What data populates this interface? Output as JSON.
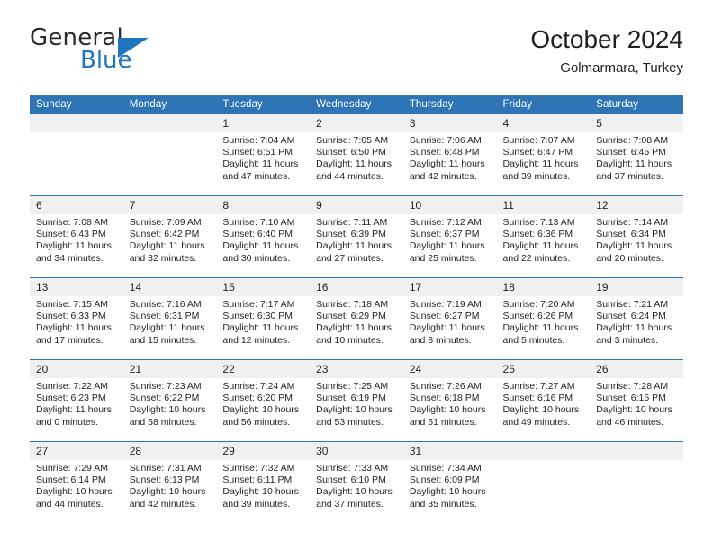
{
  "brand": {
    "name_part1": "General",
    "name_part2": "Blue",
    "flag_icon": "triangle-flag-icon"
  },
  "header": {
    "title": "October 2024",
    "subtitle": "Golmarmara, Turkey"
  },
  "colors": {
    "header_blue": "#2e75b6",
    "brand_blue": "#1f76bc",
    "daynum_band": "#f0f0f0",
    "text": "#231f20"
  },
  "calendar": {
    "weekday_headers": [
      "Sunday",
      "Monday",
      "Tuesday",
      "Wednesday",
      "Thursday",
      "Friday",
      "Saturday"
    ],
    "weeks": [
      [
        {
          "empty": true,
          "day": ""
        },
        {
          "empty": true,
          "day": ""
        },
        {
          "day": "1",
          "sunrise": "Sunrise: 7:04 AM",
          "sunset": "Sunset: 6:51 PM",
          "daylight_line1": "Daylight: 11 hours",
          "daylight_line2": "and 47 minutes."
        },
        {
          "day": "2",
          "sunrise": "Sunrise: 7:05 AM",
          "sunset": "Sunset: 6:50 PM",
          "daylight_line1": "Daylight: 11 hours",
          "daylight_line2": "and 44 minutes."
        },
        {
          "day": "3",
          "sunrise": "Sunrise: 7:06 AM",
          "sunset": "Sunset: 6:48 PM",
          "daylight_line1": "Daylight: 11 hours",
          "daylight_line2": "and 42 minutes."
        },
        {
          "day": "4",
          "sunrise": "Sunrise: 7:07 AM",
          "sunset": "Sunset: 6:47 PM",
          "daylight_line1": "Daylight: 11 hours",
          "daylight_line2": "and 39 minutes."
        },
        {
          "day": "5",
          "sunrise": "Sunrise: 7:08 AM",
          "sunset": "Sunset: 6:45 PM",
          "daylight_line1": "Daylight: 11 hours",
          "daylight_line2": "and 37 minutes."
        }
      ],
      [
        {
          "day": "6",
          "sunrise": "Sunrise: 7:08 AM",
          "sunset": "Sunset: 6:43 PM",
          "daylight_line1": "Daylight: 11 hours",
          "daylight_line2": "and 34 minutes."
        },
        {
          "day": "7",
          "sunrise": "Sunrise: 7:09 AM",
          "sunset": "Sunset: 6:42 PM",
          "daylight_line1": "Daylight: 11 hours",
          "daylight_line2": "and 32 minutes."
        },
        {
          "day": "8",
          "sunrise": "Sunrise: 7:10 AM",
          "sunset": "Sunset: 6:40 PM",
          "daylight_line1": "Daylight: 11 hours",
          "daylight_line2": "and 30 minutes."
        },
        {
          "day": "9",
          "sunrise": "Sunrise: 7:11 AM",
          "sunset": "Sunset: 6:39 PM",
          "daylight_line1": "Daylight: 11 hours",
          "daylight_line2": "and 27 minutes."
        },
        {
          "day": "10",
          "sunrise": "Sunrise: 7:12 AM",
          "sunset": "Sunset: 6:37 PM",
          "daylight_line1": "Daylight: 11 hours",
          "daylight_line2": "and 25 minutes."
        },
        {
          "day": "11",
          "sunrise": "Sunrise: 7:13 AM",
          "sunset": "Sunset: 6:36 PM",
          "daylight_line1": "Daylight: 11 hours",
          "daylight_line2": "and 22 minutes."
        },
        {
          "day": "12",
          "sunrise": "Sunrise: 7:14 AM",
          "sunset": "Sunset: 6:34 PM",
          "daylight_line1": "Daylight: 11 hours",
          "daylight_line2": "and 20 minutes."
        }
      ],
      [
        {
          "day": "13",
          "sunrise": "Sunrise: 7:15 AM",
          "sunset": "Sunset: 6:33 PM",
          "daylight_line1": "Daylight: 11 hours",
          "daylight_line2": "and 17 minutes."
        },
        {
          "day": "14",
          "sunrise": "Sunrise: 7:16 AM",
          "sunset": "Sunset: 6:31 PM",
          "daylight_line1": "Daylight: 11 hours",
          "daylight_line2": "and 15 minutes."
        },
        {
          "day": "15",
          "sunrise": "Sunrise: 7:17 AM",
          "sunset": "Sunset: 6:30 PM",
          "daylight_line1": "Daylight: 11 hours",
          "daylight_line2": "and 12 minutes."
        },
        {
          "day": "16",
          "sunrise": "Sunrise: 7:18 AM",
          "sunset": "Sunset: 6:29 PM",
          "daylight_line1": "Daylight: 11 hours",
          "daylight_line2": "and 10 minutes."
        },
        {
          "day": "17",
          "sunrise": "Sunrise: 7:19 AM",
          "sunset": "Sunset: 6:27 PM",
          "daylight_line1": "Daylight: 11 hours",
          "daylight_line2": "and 8 minutes."
        },
        {
          "day": "18",
          "sunrise": "Sunrise: 7:20 AM",
          "sunset": "Sunset: 6:26 PM",
          "daylight_line1": "Daylight: 11 hours",
          "daylight_line2": "and 5 minutes."
        },
        {
          "day": "19",
          "sunrise": "Sunrise: 7:21 AM",
          "sunset": "Sunset: 6:24 PM",
          "daylight_line1": "Daylight: 11 hours",
          "daylight_line2": "and 3 minutes."
        }
      ],
      [
        {
          "day": "20",
          "sunrise": "Sunrise: 7:22 AM",
          "sunset": "Sunset: 6:23 PM",
          "daylight_line1": "Daylight: 11 hours",
          "daylight_line2": "and 0 minutes."
        },
        {
          "day": "21",
          "sunrise": "Sunrise: 7:23 AM",
          "sunset": "Sunset: 6:22 PM",
          "daylight_line1": "Daylight: 10 hours",
          "daylight_line2": "and 58 minutes."
        },
        {
          "day": "22",
          "sunrise": "Sunrise: 7:24 AM",
          "sunset": "Sunset: 6:20 PM",
          "daylight_line1": "Daylight: 10 hours",
          "daylight_line2": "and 56 minutes."
        },
        {
          "day": "23",
          "sunrise": "Sunrise: 7:25 AM",
          "sunset": "Sunset: 6:19 PM",
          "daylight_line1": "Daylight: 10 hours",
          "daylight_line2": "and 53 minutes."
        },
        {
          "day": "24",
          "sunrise": "Sunrise: 7:26 AM",
          "sunset": "Sunset: 6:18 PM",
          "daylight_line1": "Daylight: 10 hours",
          "daylight_line2": "and 51 minutes."
        },
        {
          "day": "25",
          "sunrise": "Sunrise: 7:27 AM",
          "sunset": "Sunset: 6:16 PM",
          "daylight_line1": "Daylight: 10 hours",
          "daylight_line2": "and 49 minutes."
        },
        {
          "day": "26",
          "sunrise": "Sunrise: 7:28 AM",
          "sunset": "Sunset: 6:15 PM",
          "daylight_line1": "Daylight: 10 hours",
          "daylight_line2": "and 46 minutes."
        }
      ],
      [
        {
          "day": "27",
          "sunrise": "Sunrise: 7:29 AM",
          "sunset": "Sunset: 6:14 PM",
          "daylight_line1": "Daylight: 10 hours",
          "daylight_line2": "and 44 minutes."
        },
        {
          "day": "28",
          "sunrise": "Sunrise: 7:31 AM",
          "sunset": "Sunset: 6:13 PM",
          "daylight_line1": "Daylight: 10 hours",
          "daylight_line2": "and 42 minutes."
        },
        {
          "day": "29",
          "sunrise": "Sunrise: 7:32 AM",
          "sunset": "Sunset: 6:11 PM",
          "daylight_line1": "Daylight: 10 hours",
          "daylight_line2": "and 39 minutes."
        },
        {
          "day": "30",
          "sunrise": "Sunrise: 7:33 AM",
          "sunset": "Sunset: 6:10 PM",
          "daylight_line1": "Daylight: 10 hours",
          "daylight_line2": "and 37 minutes."
        },
        {
          "day": "31",
          "sunrise": "Sunrise: 7:34 AM",
          "sunset": "Sunset: 6:09 PM",
          "daylight_line1": "Daylight: 10 hours",
          "daylight_line2": "and 35 minutes."
        },
        {
          "empty": true,
          "day": ""
        },
        {
          "empty": true,
          "day": ""
        }
      ]
    ]
  }
}
